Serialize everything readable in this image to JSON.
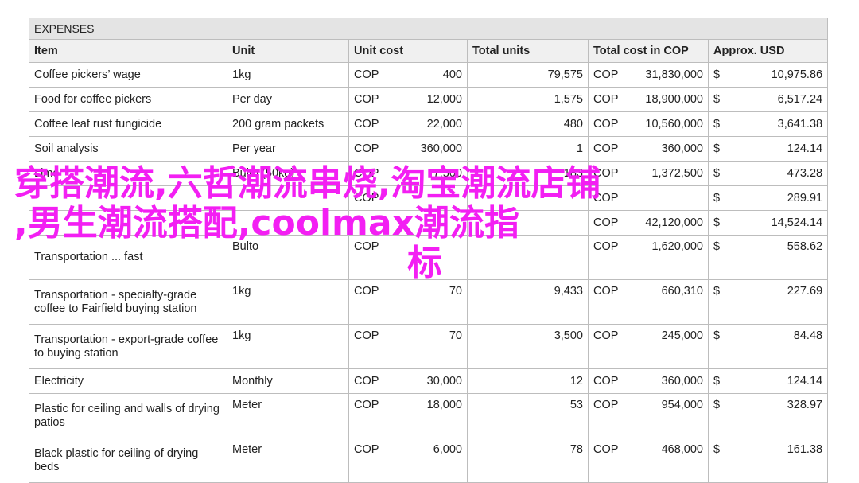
{
  "table": {
    "title": "EXPENSES",
    "headers": [
      "Item",
      "Unit",
      "Unit cost",
      "Total units",
      "Total cost in COP",
      "Approx. USD"
    ],
    "rows": [
      {
        "item": "Coffee pickers’ wage",
        "unit": "1kg",
        "unit_cur": "COP",
        "unit_cost": "400",
        "total_units": "79,575",
        "cost_cur": "COP",
        "total_cost": "31,830,000",
        "usd_sym": "$",
        "usd": "10,975.86",
        "tall": false
      },
      {
        "item": "Food for coffee pickers",
        "unit": "Per day",
        "unit_cur": "COP",
        "unit_cost": "12,000",
        "total_units": "1,575",
        "cost_cur": "COP",
        "total_cost": "18,900,000",
        "usd_sym": "$",
        "usd": "6,517.24",
        "tall": false
      },
      {
        "item": "Coffee leaf rust fungicide",
        "unit": "200 gram packets",
        "unit_cur": "COP",
        "unit_cost": "22,000",
        "total_units": "480",
        "cost_cur": "COP",
        "total_cost": "10,560,000",
        "usd_sym": "$",
        "usd": "3,641.38",
        "tall": false
      },
      {
        "item": "Soil analysis",
        "unit": "Per year",
        "unit_cur": "COP",
        "unit_cost": "360,000",
        "total_units": "1",
        "cost_cur": "COP",
        "total_cost": "360,000",
        "usd_sym": "$",
        "usd": "124.14",
        "tall": false
      },
      {
        "item": "Lime",
        "unit": "Bulto (50kg)",
        "unit_cur": "COP",
        "unit_cost": "7,500",
        "total_units": "183",
        "cost_cur": "COP",
        "total_cost": "1,372,500",
        "usd_sym": "$",
        "usd": "473.28",
        "tall": false
      },
      {
        "item": "",
        "unit": "",
        "unit_cur": "COP",
        "unit_cost": "",
        "total_units": "",
        "cost_cur": "COP",
        "total_cost": "",
        "usd_sym": "$",
        "usd": "289.91",
        "tall": false
      },
      {
        "item": "",
        "unit": "",
        "unit_cur": "",
        "unit_cost": "",
        "total_units": "",
        "cost_cur": "COP",
        "total_cost": "42,120,000",
        "usd_sym": "$",
        "usd": "14,524.14",
        "tall": false
      },
      {
        "item": "Transportation ... fast",
        "unit": "Bulto",
        "unit_cur": "COP",
        "unit_cost": "",
        "total_units": "",
        "cost_cur": "COP",
        "total_cost": "1,620,000",
        "usd_sym": "$",
        "usd": "558.62",
        "tall": true
      },
      {
        "item": "Transportation - specialty-grade coffee to Fairfield buying station",
        "unit": "1kg",
        "unit_cur": "COP",
        "unit_cost": "70",
        "total_units": "9,433",
        "cost_cur": "COP",
        "total_cost": "660,310",
        "usd_sym": "$",
        "usd": "227.69",
        "tall": true
      },
      {
        "item": "Transportation - export-grade coffee to buying station",
        "unit": "1kg",
        "unit_cur": "COP",
        "unit_cost": "70",
        "total_units": "3,500",
        "cost_cur": "COP",
        "total_cost": "245,000",
        "usd_sym": "$",
        "usd": "84.48",
        "tall": true
      },
      {
        "item": "Electricity",
        "unit": "Monthly",
        "unit_cur": "COP",
        "unit_cost": "30,000",
        "total_units": "12",
        "cost_cur": "COP",
        "total_cost": "360,000",
        "usd_sym": "$",
        "usd": "124.14",
        "tall": false
      },
      {
        "item": "Plastic for ceiling and walls of drying patios",
        "unit": "Meter",
        "unit_cur": "COP",
        "unit_cost": "18,000",
        "total_units": "53",
        "cost_cur": "COP",
        "total_cost": "954,000",
        "usd_sym": "$",
        "usd": "328.97",
        "tall": true
      },
      {
        "item": "Black plastic for ceiling of drying beds",
        "unit": "Meter",
        "unit_cur": "COP",
        "unit_cost": "6,000",
        "total_units": "78",
        "cost_cur": "COP",
        "total_cost": "468,000",
        "usd_sym": "$",
        "usd": "161.38",
        "tall": true
      }
    ]
  },
  "overlay": {
    "line1": "穿搭潮流,六哲潮流串烧,淘宝潮流店铺",
    "line2": ",男生潮流搭配,coolmax潮流指",
    "line3": "标"
  }
}
